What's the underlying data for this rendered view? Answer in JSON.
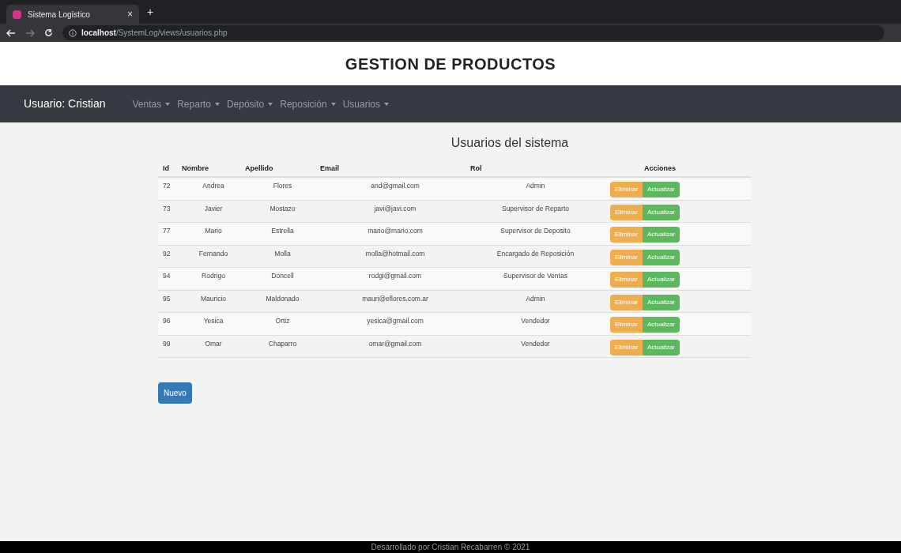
{
  "browser": {
    "tab_title": "Sistema Logístico",
    "new_tab": "+",
    "close": "×",
    "url_host": "localhost",
    "url_path": "/SystemLog/views/usuarios.php"
  },
  "page_title": "GESTION DE PRODUCTOS",
  "navbar": {
    "user": "Usuario: Cristian",
    "menus": [
      "Ventas",
      "Reparto",
      "Depósito",
      "Reposición",
      "Usuarios"
    ]
  },
  "heading": "Usuarios del sistema",
  "table": {
    "columns": [
      "Id",
      "Nombre",
      "Apellido",
      "Email",
      "Rol",
      "Acciones"
    ],
    "rows": [
      {
        "id": "72",
        "nombre": "Andrea",
        "apellido": "Flores",
        "email": "and@gmail.com",
        "rol": "Admin",
        "delete": "Eliminar",
        "update": "Actualizar"
      },
      {
        "id": "73",
        "nombre": "Javier",
        "apellido": "Mostazo",
        "email": "javi@javi.com",
        "rol": "Supervisor de Reparto",
        "delete": "Eliminar",
        "update": "Actualizar"
      },
      {
        "id": "77",
        "nombre": "Mario",
        "apellido": "Estrella",
        "email": "mario@mario.com",
        "rol": "Supervisor de Deposito",
        "delete": "Eliminar",
        "update": "Actualizar"
      },
      {
        "id": "92",
        "nombre": "Fernando",
        "apellido": "Molla",
        "email": "molla@hotmail.com",
        "rol": "Encargado de Reposición",
        "delete": "Eliminar",
        "update": "Actualizar"
      },
      {
        "id": "94",
        "nombre": "Rodrigo",
        "apellido": "Doncell",
        "email": "rodgi@gmail.com",
        "rol": "Supervisor de Ventas",
        "delete": "Eliminar",
        "update": "Actualizar"
      },
      {
        "id": "95",
        "nombre": "Mauricio",
        "apellido": "Maldonado",
        "email": "mauri@eflores.com.ar",
        "rol": "Admin",
        "delete": "Eliminar",
        "update": "Actualizar"
      },
      {
        "id": "96",
        "nombre": "Yesica",
        "apellido": "Ortiz",
        "email": "yesica@gmail.com",
        "rol": "Vendedor",
        "delete": "Eliminar",
        "update": "Actualizar"
      },
      {
        "id": "99",
        "nombre": "Omar",
        "apellido": "Chaparro",
        "email": "omar@gmail.com",
        "rol": "Vendedor",
        "delete": "Eliminar",
        "update": "Actualizar"
      }
    ]
  },
  "new_button": "Nuevo",
  "footer": "Desarrollado por Cristian Recabarren © 2021"
}
